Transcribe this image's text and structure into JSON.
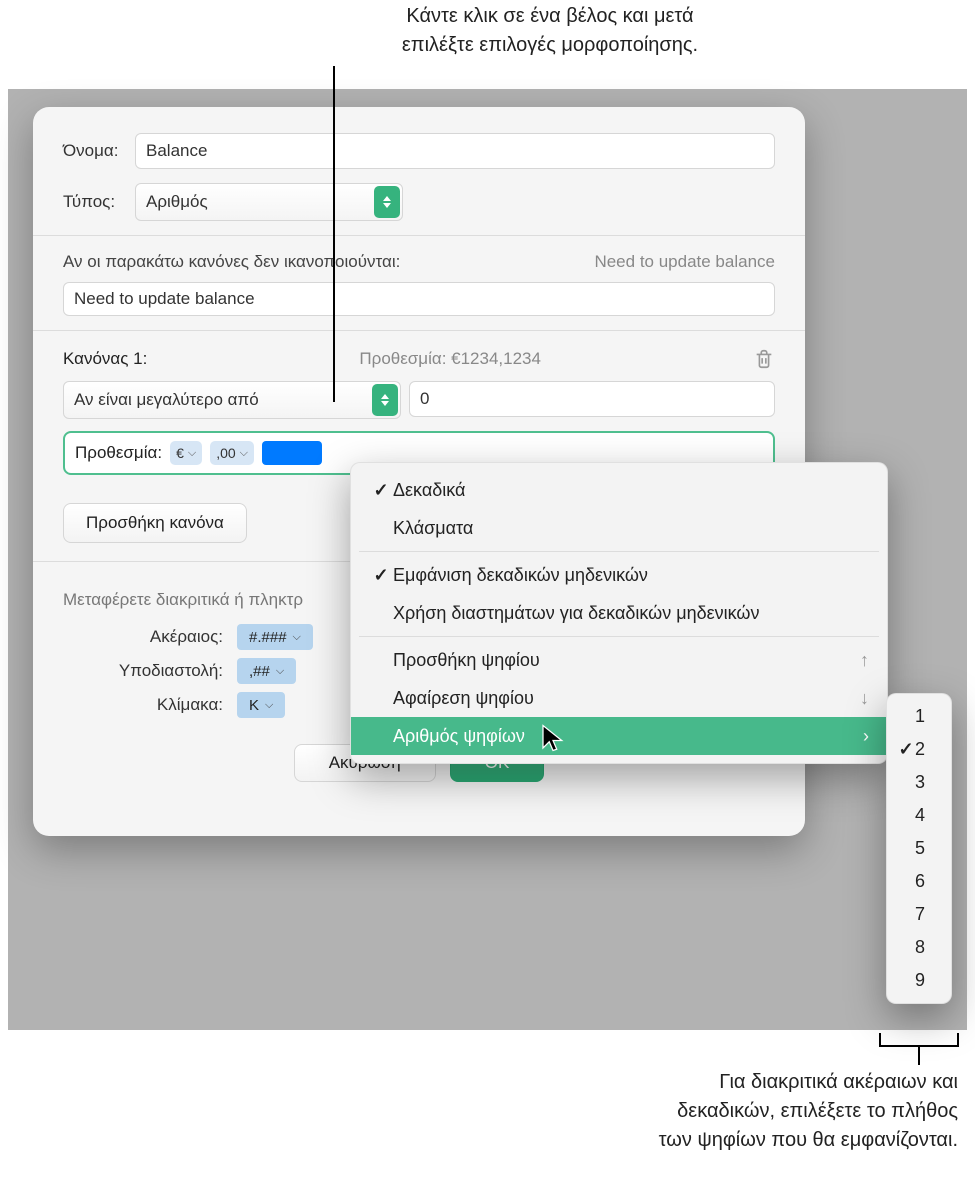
{
  "callouts": {
    "top_line1": "Κάντε κλικ σε ένα βέλος και μετά",
    "top_line2": "επιλέξτε επιλογές μορφοποίησης.",
    "bottom_line1": "Για διακριτικά ακέραιων και",
    "bottom_line2": "δεκαδικών, επιλέξετε το πλήθος",
    "bottom_line3": "των ψηφίων που θα εμφανίζονται."
  },
  "form": {
    "name_label": "Όνομα:",
    "name_value": "Balance",
    "type_label": "Τύπος:",
    "type_value": "Αριθμός",
    "rules_hint": "Αν οι παρακάτω κανόνες δεν ικανοποιούνται:",
    "rules_preview": "Need to update balance",
    "rules_value": "Need to update balance",
    "rule1_label": "Κανόνας 1:",
    "deadline_preview": "Προθεσμία: €1234,1234",
    "condition_value": "Αν είναι μεγαλύτερο από",
    "compare_value": "0",
    "format_bar_label": "Προθεσμία:",
    "chip_currency": "€",
    "chip_decimals": ",00",
    "add_rule": "Προσθήκη κανόνα",
    "drag_hint": "Μεταφέρετε διακριτικά ή πληκτρ",
    "tokens": {
      "integer_label": "Ακέραιος:",
      "integer_token": "#.###",
      "decimal_label": "Υποδιαστολή:",
      "decimal_token": ",##",
      "scale_label": "Κλίμακα:",
      "scale_token": "K"
    },
    "buttons": {
      "cancel": "Ακύρωση",
      "ok": "OK"
    }
  },
  "menu": {
    "items": [
      {
        "label": "Δεκαδικά",
        "checked": true
      },
      {
        "label": "Κλάσματα",
        "checked": false
      }
    ],
    "group2": [
      {
        "label": "Εμφάνιση δεκαδικών μηδενικών",
        "checked": true
      },
      {
        "label": "Χρήση διαστημάτων για δεκαδικών μηδενικών",
        "checked": false
      }
    ],
    "group3": [
      {
        "label": "Προσθήκη ψηφίου",
        "hint": "up"
      },
      {
        "label": "Αφαίρεση ψηφίου",
        "hint": "down"
      },
      {
        "label": "Αριθμός ψηφίων",
        "submenu": true,
        "selected": true
      }
    ]
  },
  "submenu": {
    "options": [
      "1",
      "2",
      "3",
      "4",
      "5",
      "6",
      "7",
      "8",
      "9"
    ],
    "selected": "2"
  }
}
